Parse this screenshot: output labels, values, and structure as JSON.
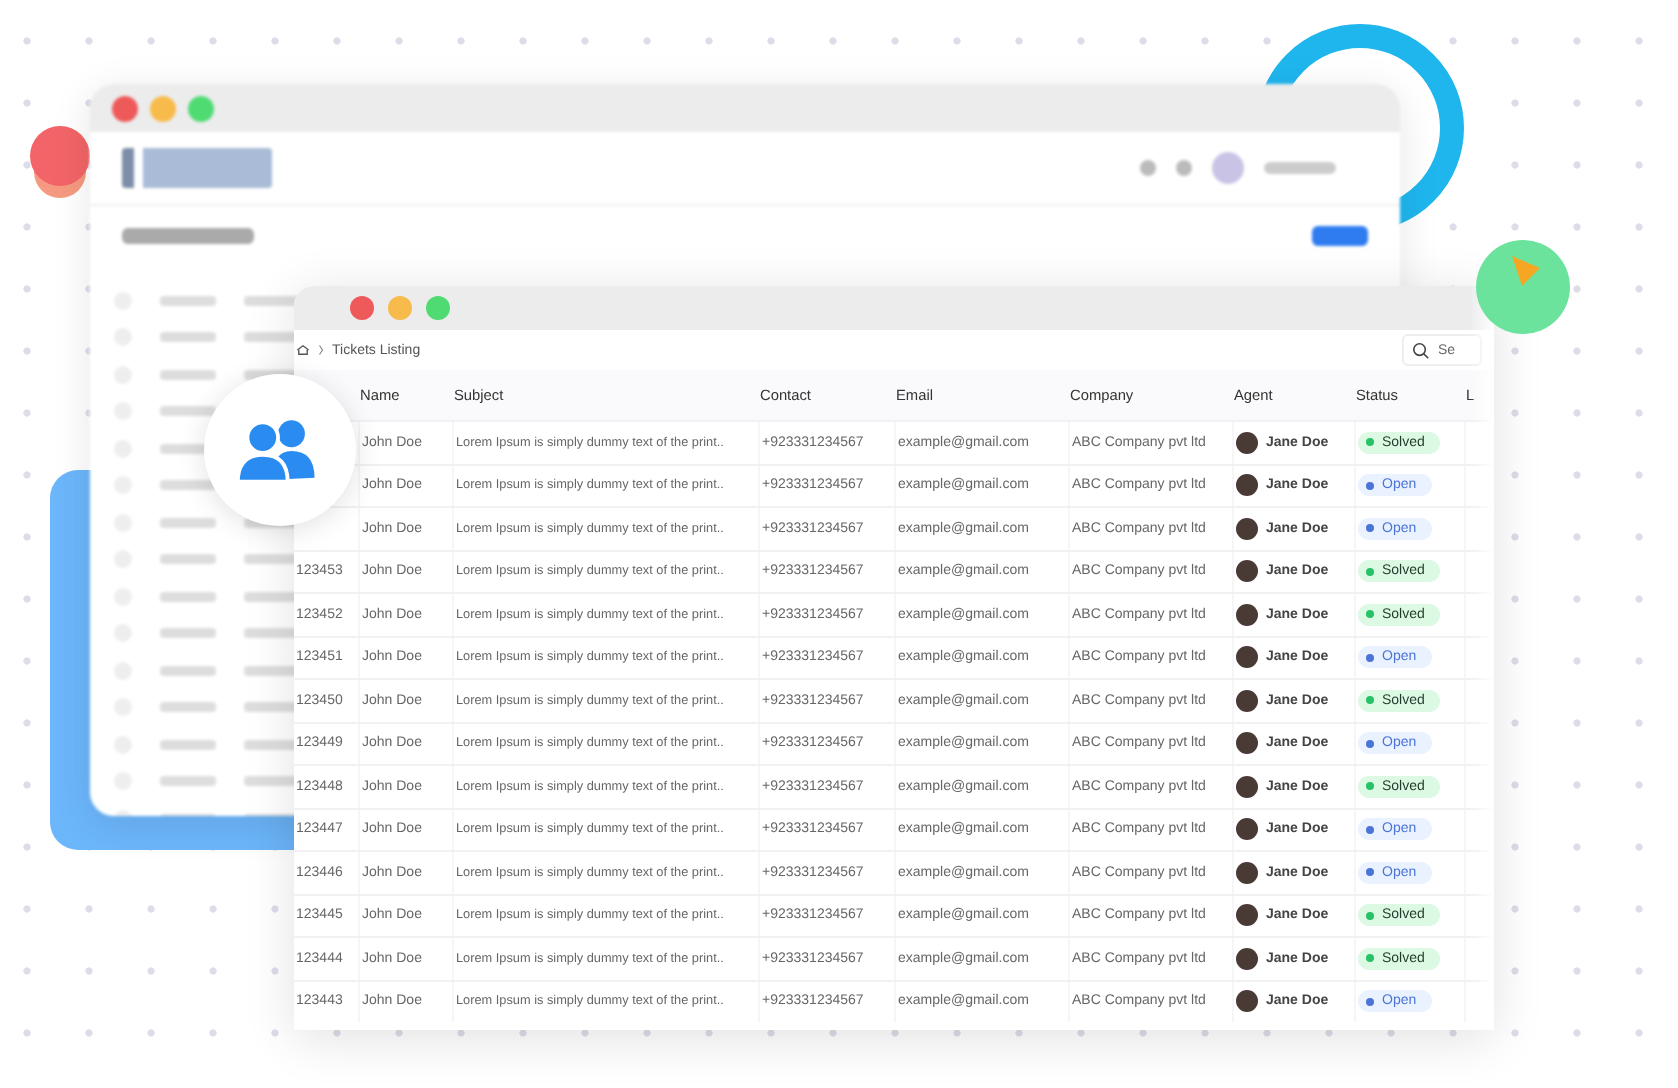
{
  "front_window": {
    "breadcrumb": {
      "current": "Tickets Listing"
    },
    "search": {
      "placeholder": "Se"
    },
    "table": {
      "columns": [
        "",
        "Name",
        "Subject",
        "Contact",
        "Email",
        "Company",
        "Agent",
        "Status",
        "L"
      ],
      "rows": [
        {
          "name": "John Doe",
          "subject": "Lorem Ipsum is simply dummy text of the print..",
          "contact": "+923331234567",
          "email": "example@gmail.com",
          "company": "ABC Company pvt ltd",
          "agent": "Jane Doe",
          "status": "Solved",
          "kind": "solved"
        },
        {
          "name": "John Doe",
          "subject": "Lorem Ipsum is simply dummy text of the print..",
          "contact": "+923331234567",
          "email": "example@gmail.com",
          "company": "ABC Company pvt ltd",
          "agent": "Jane Doe",
          "status": "Open",
          "kind": "open"
        },
        {
          "name": "John Doe",
          "subject": "Lorem Ipsum is simply dummy text of the print..",
          "contact": "+923331234567",
          "email": "example@gmail.com",
          "company": "ABC Company pvt ltd",
          "agent": "Jane Doe",
          "status": "Open",
          "kind": "open"
        },
        {
          "id": "123453",
          "name": "John Doe",
          "subject": "Lorem Ipsum is simply dummy text of the print..",
          "contact": "+923331234567",
          "email": "example@gmail.com",
          "company": "ABC Company pvt ltd",
          "agent": "Jane Doe",
          "status": "Solved",
          "kind": "solved"
        },
        {
          "id": "123452",
          "name": "John Doe",
          "subject": "Lorem Ipsum is simply dummy text of the print..",
          "contact": "+923331234567",
          "email": "example@gmail.com",
          "company": "ABC Company pvt ltd",
          "agent": "Jane Doe",
          "status": "Solved",
          "kind": "solved"
        },
        {
          "id": "123451",
          "name": "John Doe",
          "subject": "Lorem Ipsum is simply dummy text of the print..",
          "contact": "+923331234567",
          "email": "example@gmail.com",
          "company": "ABC Company pvt ltd",
          "agent": "Jane Doe",
          "status": "Open",
          "kind": "open"
        },
        {
          "id": "123450",
          "name": "John Doe",
          "subject": "Lorem Ipsum is simply dummy text of the print..",
          "contact": "+923331234567",
          "email": "example@gmail.com",
          "company": "ABC Company pvt ltd",
          "agent": "Jane Doe",
          "status": "Solved",
          "kind": "solved"
        },
        {
          "id": "123449",
          "name": "John Doe",
          "subject": "Lorem Ipsum is simply dummy text of the print..",
          "contact": "+923331234567",
          "email": "example@gmail.com",
          "company": "ABC Company pvt ltd",
          "agent": "Jane Doe",
          "status": "Open",
          "kind": "open"
        },
        {
          "id": "123448",
          "name": "John Doe",
          "subject": "Lorem Ipsum is simply dummy text of the print..",
          "contact": "+923331234567",
          "email": "example@gmail.com",
          "company": "ABC Company pvt ltd",
          "agent": "Jane Doe",
          "status": "Solved",
          "kind": "solved"
        },
        {
          "id": "123447",
          "name": "John Doe",
          "subject": "Lorem Ipsum is simply dummy text of the print..",
          "contact": "+923331234567",
          "email": "example@gmail.com",
          "company": "ABC Company pvt ltd",
          "agent": "Jane Doe",
          "status": "Open",
          "kind": "open"
        },
        {
          "id": "123446",
          "name": "John Doe",
          "subject": "Lorem Ipsum is simply dummy text of the print..",
          "contact": "+923331234567",
          "email": "example@gmail.com",
          "company": "ABC Company pvt ltd",
          "agent": "Jane Doe",
          "status": "Open",
          "kind": "open"
        },
        {
          "id": "123445",
          "name": "John Doe",
          "subject": "Lorem Ipsum is simply dummy text of the print..",
          "contact": "+923331234567",
          "email": "example@gmail.com",
          "company": "ABC Company pvt ltd",
          "agent": "Jane Doe",
          "status": "Solved",
          "kind": "solved"
        },
        {
          "id": "123444",
          "name": "John Doe",
          "subject": "Lorem Ipsum is simply dummy text of the print..",
          "contact": "+923331234567",
          "email": "example@gmail.com",
          "company": "ABC Company pvt ltd",
          "agent": "Jane Doe",
          "status": "Solved",
          "kind": "solved"
        },
        {
          "id": "123443",
          "name": "John Doe",
          "subject": "Lorem Ipsum is simply dummy text of the print..",
          "contact": "+923331234567",
          "email": "example@gmail.com",
          "company": "ABC Company pvt ltd",
          "agent": "Jane Doe",
          "status": "Open",
          "kind": "open"
        }
      ]
    }
  }
}
